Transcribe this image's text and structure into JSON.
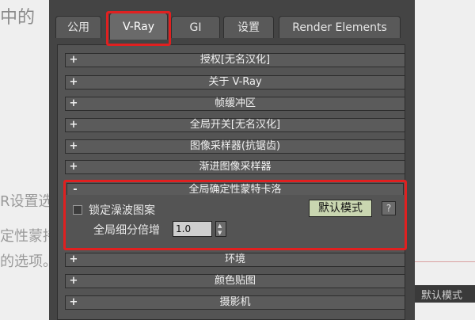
{
  "background": {
    "top_left": "中的",
    "line1": "R设置选",
    "line2": "定性蒙持",
    "line3": "的选项。"
  },
  "tabs": [
    "公用",
    "V-Ray",
    "GI",
    "设置",
    "Render Elements"
  ],
  "active_tab": "V-Ray",
  "rollouts_above": [
    {
      "sign": "+",
      "title": "授权[无名汉化]"
    },
    {
      "sign": "+",
      "title": "关于 V-Ray"
    },
    {
      "sign": "+",
      "title": "帧缓冲区"
    },
    {
      "sign": "+",
      "title": "全局开关[无名汉化]"
    },
    {
      "sign": "+",
      "title": "图像采样器(抗锯齿)"
    },
    {
      "sign": "+",
      "title": "渐进图像采样器"
    }
  ],
  "open_rollout": {
    "sign": "-",
    "title": "全局确定性蒙特卡洛",
    "lock_noise_label": "锁定澡波图案",
    "global_subdiv_label": "全局细分倍增",
    "global_subdiv_value": "1.0",
    "default_mode_button": "默认模式",
    "help_button": "?"
  },
  "rollouts_below": [
    {
      "sign": "+",
      "title": "环境"
    },
    {
      "sign": "+",
      "title": "颜色贴图"
    },
    {
      "sign": "+",
      "title": "摄影机"
    }
  ],
  "right_strip_text": "默认模式",
  "colors": {
    "highlight": "#e02020",
    "panel": "#545454",
    "button_green": "#c9d6b0"
  }
}
